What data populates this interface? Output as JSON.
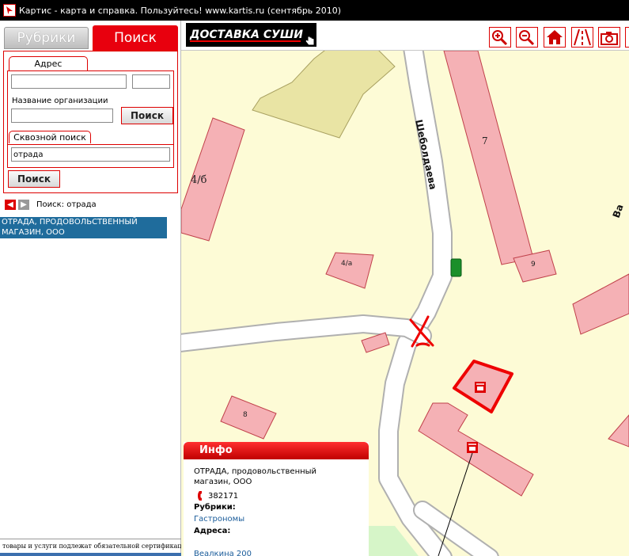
{
  "window": {
    "title": "Картис - карта и справка. Пользуйтесь! www.kartis.ru (сентябрь 2010)"
  },
  "left_panel": {
    "tabs": {
      "rubriki": "Рубрики",
      "poisk": "Поиск"
    },
    "address_tab": "Адрес",
    "address_street_value": "",
    "address_house_value": "",
    "org_label": "Название организации",
    "org_value": "",
    "search_button": "Поиск",
    "through_tab": "Сквозной поиск",
    "through_value": "отрада",
    "through_button": "Поиск",
    "search_caption": "Поиск: отрада",
    "results": [
      "ОТРАДА, ПРОДОВОЛЬСТВЕННЫЙ МАГАЗИН, ООО"
    ],
    "footer_note": "товары и услуги подлежат обязательной сертификации"
  },
  "toolbar": {
    "banner": "ДОСТАВКА СУШИ",
    "tools": [
      "zoom-in-icon",
      "zoom-out-icon",
      "home-icon",
      "road-icon",
      "camera-icon"
    ]
  },
  "map": {
    "street_name": "Шеболдаева",
    "street_partial": "Ва",
    "buildings": {
      "b7": "7",
      "b9": "9",
      "b4b": "4/б",
      "b4a": "4/а",
      "b8": "8"
    }
  },
  "info": {
    "title": "Инфо",
    "org_name_line1": "ОТРАДА, продовольственный",
    "org_name_line2": "магазин, ООО",
    "phone": "382171",
    "rubrics_label": "Рубрики:",
    "rubric": "Гастрономы",
    "address_label": "Адреса:",
    "address_value": "Веалкина 200"
  },
  "colors": {
    "accent": "#e8000e",
    "selection": "#1f6c9c",
    "building": "#f5b1b5",
    "building_stroke": "#c0404a",
    "map_bg": "#fdfbd6"
  }
}
